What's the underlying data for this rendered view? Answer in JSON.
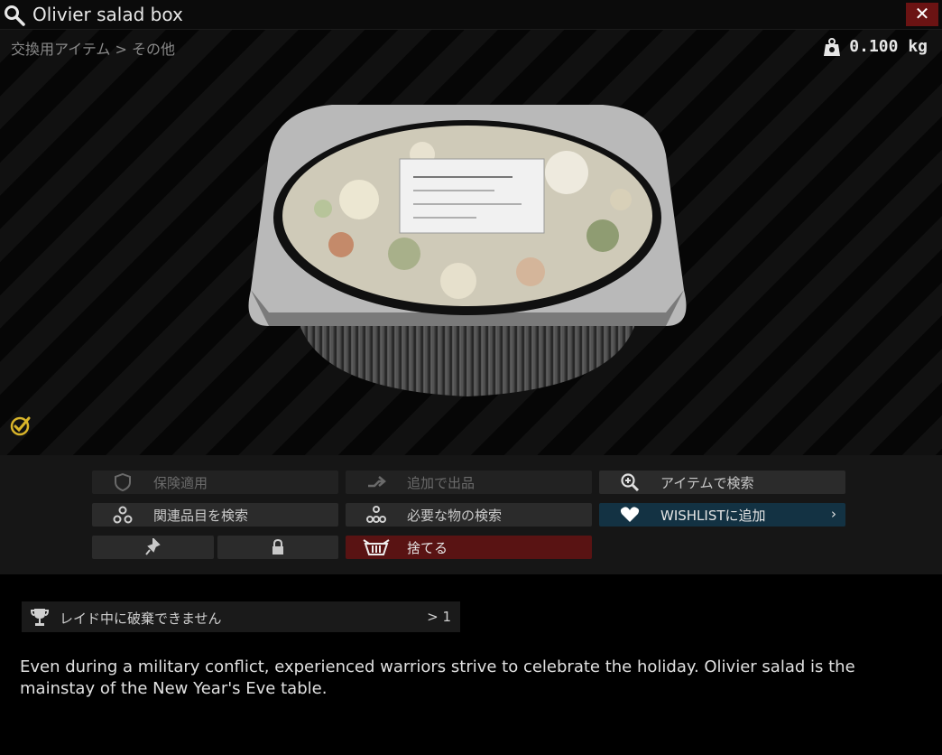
{
  "window": {
    "title": "Olivier salad box",
    "close_label": "✕"
  },
  "breadcrumb": "交換用アイテム > その他",
  "weight": "0.100 kg",
  "colors": {
    "danger": "#591313",
    "wishlist": "#133243",
    "check": "#d9b52a"
  },
  "icons": [
    "search-icon",
    "close-icon",
    "weight-icon",
    "check-icon",
    "shield-icon",
    "sell-icon",
    "magnify-plus-icon",
    "linked-icon",
    "required-icon",
    "heart-icon",
    "pin-icon",
    "lock-icon",
    "discard-icon",
    "trophy-icon"
  ],
  "actions": {
    "insure": "保険適用",
    "sell": "追加で出品",
    "search_item": "アイテムで検索",
    "linked_search": "関連品目を検索",
    "required_search": "必要な物の検索",
    "wishlist": "WISHLISTに追加",
    "wishlist_chevron": "›",
    "discard": "捨てる"
  },
  "info": {
    "text": "レイド中に破棄できません",
    "count": "> 1"
  },
  "description": "Even during a military conflict, experienced warriors strive to celebrate the holiday. Olivier salad is the mainstay of the New Year's Eve table."
}
